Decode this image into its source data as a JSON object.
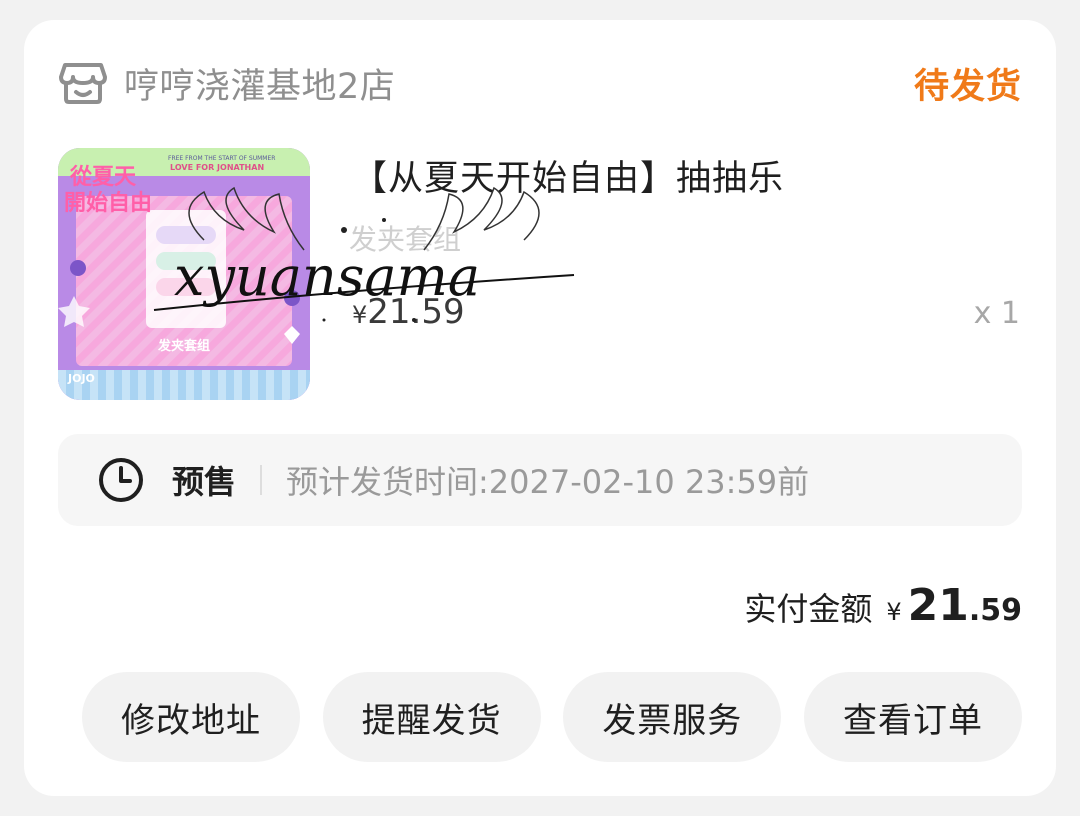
{
  "store": {
    "name": "哼哼浇灌基地2店",
    "icon": "store-icon"
  },
  "order": {
    "status": "待发货"
  },
  "product": {
    "title": "【从夏天开始自由】抽抽乐",
    "spec": "发夹套组",
    "price_symbol": "¥",
    "price_value": "21.59",
    "quantity": "x 1",
    "thumbnail": {
      "title_art": "從夏天開始自由",
      "subtitle": "FREE FROM THE START OF SUMMER",
      "line2": "LOVE FOR JONATHAN",
      "card_label": "发夹套组",
      "corner_tag": "JOJO"
    },
    "watermark": "xyuansama"
  },
  "presale": {
    "icon": "clock-icon",
    "label": "预售",
    "ship_time": "预计发货时间:2027-02-10 23:59前"
  },
  "payment": {
    "label": "实付金额",
    "currency": "¥",
    "integer": "21",
    "decimal": ".59"
  },
  "actions": [
    {
      "label": "修改地址"
    },
    {
      "label": "提醒发货"
    },
    {
      "label": "发票服务"
    },
    {
      "label": "查看订单"
    }
  ],
  "colors": {
    "accent": "#f07a19",
    "card_bg": "#ffffff",
    "page_bg": "#f2f2f2"
  }
}
